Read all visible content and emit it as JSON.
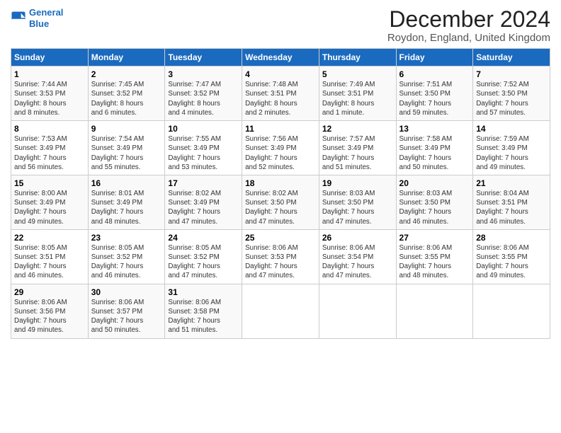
{
  "logo": {
    "line1": "General",
    "line2": "Blue"
  },
  "title": "December 2024",
  "subtitle": "Roydon, England, United Kingdom",
  "days_header": [
    "Sunday",
    "Monday",
    "Tuesday",
    "Wednesday",
    "Thursday",
    "Friday",
    "Saturday"
  ],
  "weeks": [
    [
      {
        "day": "1",
        "info": "Sunrise: 7:44 AM\nSunset: 3:53 PM\nDaylight: 8 hours\nand 8 minutes."
      },
      {
        "day": "2",
        "info": "Sunrise: 7:45 AM\nSunset: 3:52 PM\nDaylight: 8 hours\nand 6 minutes."
      },
      {
        "day": "3",
        "info": "Sunrise: 7:47 AM\nSunset: 3:52 PM\nDaylight: 8 hours\nand 4 minutes."
      },
      {
        "day": "4",
        "info": "Sunrise: 7:48 AM\nSunset: 3:51 PM\nDaylight: 8 hours\nand 2 minutes."
      },
      {
        "day": "5",
        "info": "Sunrise: 7:49 AM\nSunset: 3:51 PM\nDaylight: 8 hours\nand 1 minute."
      },
      {
        "day": "6",
        "info": "Sunrise: 7:51 AM\nSunset: 3:50 PM\nDaylight: 7 hours\nand 59 minutes."
      },
      {
        "day": "7",
        "info": "Sunrise: 7:52 AM\nSunset: 3:50 PM\nDaylight: 7 hours\nand 57 minutes."
      }
    ],
    [
      {
        "day": "8",
        "info": "Sunrise: 7:53 AM\nSunset: 3:49 PM\nDaylight: 7 hours\nand 56 minutes."
      },
      {
        "day": "9",
        "info": "Sunrise: 7:54 AM\nSunset: 3:49 PM\nDaylight: 7 hours\nand 55 minutes."
      },
      {
        "day": "10",
        "info": "Sunrise: 7:55 AM\nSunset: 3:49 PM\nDaylight: 7 hours\nand 53 minutes."
      },
      {
        "day": "11",
        "info": "Sunrise: 7:56 AM\nSunset: 3:49 PM\nDaylight: 7 hours\nand 52 minutes."
      },
      {
        "day": "12",
        "info": "Sunrise: 7:57 AM\nSunset: 3:49 PM\nDaylight: 7 hours\nand 51 minutes."
      },
      {
        "day": "13",
        "info": "Sunrise: 7:58 AM\nSunset: 3:49 PM\nDaylight: 7 hours\nand 50 minutes."
      },
      {
        "day": "14",
        "info": "Sunrise: 7:59 AM\nSunset: 3:49 PM\nDaylight: 7 hours\nand 49 minutes."
      }
    ],
    [
      {
        "day": "15",
        "info": "Sunrise: 8:00 AM\nSunset: 3:49 PM\nDaylight: 7 hours\nand 49 minutes."
      },
      {
        "day": "16",
        "info": "Sunrise: 8:01 AM\nSunset: 3:49 PM\nDaylight: 7 hours\nand 48 minutes."
      },
      {
        "day": "17",
        "info": "Sunrise: 8:02 AM\nSunset: 3:49 PM\nDaylight: 7 hours\nand 47 minutes."
      },
      {
        "day": "18",
        "info": "Sunrise: 8:02 AM\nSunset: 3:50 PM\nDaylight: 7 hours\nand 47 minutes."
      },
      {
        "day": "19",
        "info": "Sunrise: 8:03 AM\nSunset: 3:50 PM\nDaylight: 7 hours\nand 47 minutes."
      },
      {
        "day": "20",
        "info": "Sunrise: 8:03 AM\nSunset: 3:50 PM\nDaylight: 7 hours\nand 46 minutes."
      },
      {
        "day": "21",
        "info": "Sunrise: 8:04 AM\nSunset: 3:51 PM\nDaylight: 7 hours\nand 46 minutes."
      }
    ],
    [
      {
        "day": "22",
        "info": "Sunrise: 8:05 AM\nSunset: 3:51 PM\nDaylight: 7 hours\nand 46 minutes."
      },
      {
        "day": "23",
        "info": "Sunrise: 8:05 AM\nSunset: 3:52 PM\nDaylight: 7 hours\nand 46 minutes."
      },
      {
        "day": "24",
        "info": "Sunrise: 8:05 AM\nSunset: 3:52 PM\nDaylight: 7 hours\nand 47 minutes."
      },
      {
        "day": "25",
        "info": "Sunrise: 8:06 AM\nSunset: 3:53 PM\nDaylight: 7 hours\nand 47 minutes."
      },
      {
        "day": "26",
        "info": "Sunrise: 8:06 AM\nSunset: 3:54 PM\nDaylight: 7 hours\nand 47 minutes."
      },
      {
        "day": "27",
        "info": "Sunrise: 8:06 AM\nSunset: 3:55 PM\nDaylight: 7 hours\nand 48 minutes."
      },
      {
        "day": "28",
        "info": "Sunrise: 8:06 AM\nSunset: 3:55 PM\nDaylight: 7 hours\nand 49 minutes."
      }
    ],
    [
      {
        "day": "29",
        "info": "Sunrise: 8:06 AM\nSunset: 3:56 PM\nDaylight: 7 hours\nand 49 minutes."
      },
      {
        "day": "30",
        "info": "Sunrise: 8:06 AM\nSunset: 3:57 PM\nDaylight: 7 hours\nand 50 minutes."
      },
      {
        "day": "31",
        "info": "Sunrise: 8:06 AM\nSunset: 3:58 PM\nDaylight: 7 hours\nand 51 minutes."
      },
      {
        "day": "",
        "info": ""
      },
      {
        "day": "",
        "info": ""
      },
      {
        "day": "",
        "info": ""
      },
      {
        "day": "",
        "info": ""
      }
    ]
  ]
}
